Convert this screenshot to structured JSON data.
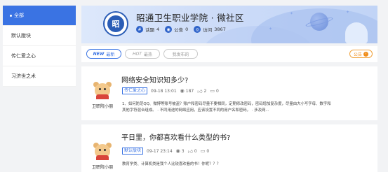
{
  "sidebar": {
    "items": [
      {
        "label": "全部",
        "active": true
      },
      {
        "label": "默认版块",
        "active": false
      },
      {
        "label": "传仁爱之心",
        "active": false
      },
      {
        "label": "习济世之术",
        "active": false
      }
    ]
  },
  "banner": {
    "logo_char": "昭",
    "title": "昭通卫生职业学院 · 微社区",
    "stats": {
      "topics_label": "话题",
      "topics_count": "4",
      "notices_label": "公告",
      "notices_count": "0",
      "visits_label": "访问",
      "visits_count": "3867"
    }
  },
  "tabs": [
    {
      "en": "NEW",
      "label": "最新",
      "active": true
    },
    {
      "en": "HOT",
      "label": "最热",
      "active": false
    },
    {
      "en": "",
      "label": "我发布的",
      "active": false
    }
  ],
  "notice_button": {
    "label": "公告"
  },
  "posts": [
    {
      "title": "网络安全知识知多少?",
      "author": "卫职院小朋",
      "tag": "传仁爱之心",
      "time": "09-18 13:01",
      "views": "187",
      "likes": "2",
      "comments": "0",
      "excerpt_line1": "1、如何防范QQ、微博等账号被盗？账户和密码尽量不要相同，定期修改密码，密码增加复杂度，尽量由大小写字母、数字和",
      "excerpt_line2": "其他字符混合组成。 · 不同用途的网络应用，应该设置不同的用户名和密码， · 涉及网..."
    },
    {
      "title": "平日里，你都喜欢看什么类型的书?",
      "author": "卫职院小朋",
      "tag": "默认版块",
      "time": "09-17 23:14",
      "views": "3",
      "likes": "0",
      "comments": "0",
      "excerpt_line1": "教育学类、计算机类是我个人比较喜欢看的书！你呢？？？",
      "excerpt_line2": ""
    }
  ],
  "icons": {
    "view": "eye-icon",
    "like": "thumb-up-icon",
    "comment": "comment-icon"
  },
  "colors": {
    "primary": "#3a73e3",
    "notice": "#f08d1a",
    "stat_icon": "#2f63c9"
  }
}
